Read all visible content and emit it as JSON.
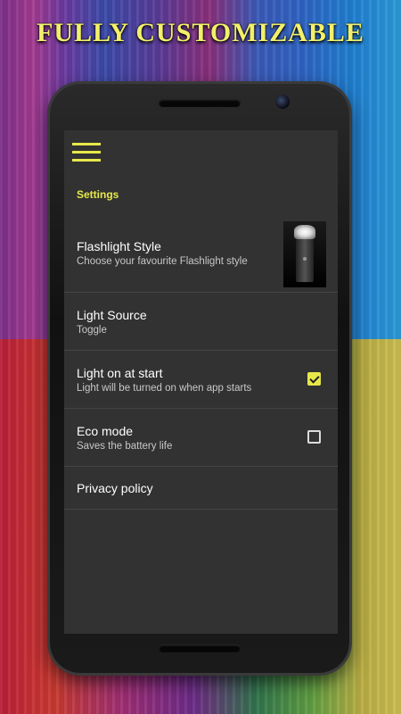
{
  "promo": {
    "title": "FULLY CUSTOMIZABLE"
  },
  "settings": {
    "section_header": "Settings",
    "items": [
      {
        "title": "Flashlight Style",
        "subtitle": "Choose your favourite Flashlight style"
      },
      {
        "title": "Light Source",
        "subtitle": "Toggle"
      },
      {
        "title": "Light on at start",
        "subtitle": "Light will be turned on when app starts",
        "checked": true
      },
      {
        "title": "Eco mode",
        "subtitle": "Saves the battery life",
        "checked": false
      },
      {
        "title": "Privacy policy"
      }
    ]
  },
  "colors": {
    "accent": "#e6e84a",
    "screen_bg": "#323232"
  },
  "icons": {
    "menu": "hamburger-menu-icon",
    "preview": "flashlight-preview-thumbnail"
  }
}
